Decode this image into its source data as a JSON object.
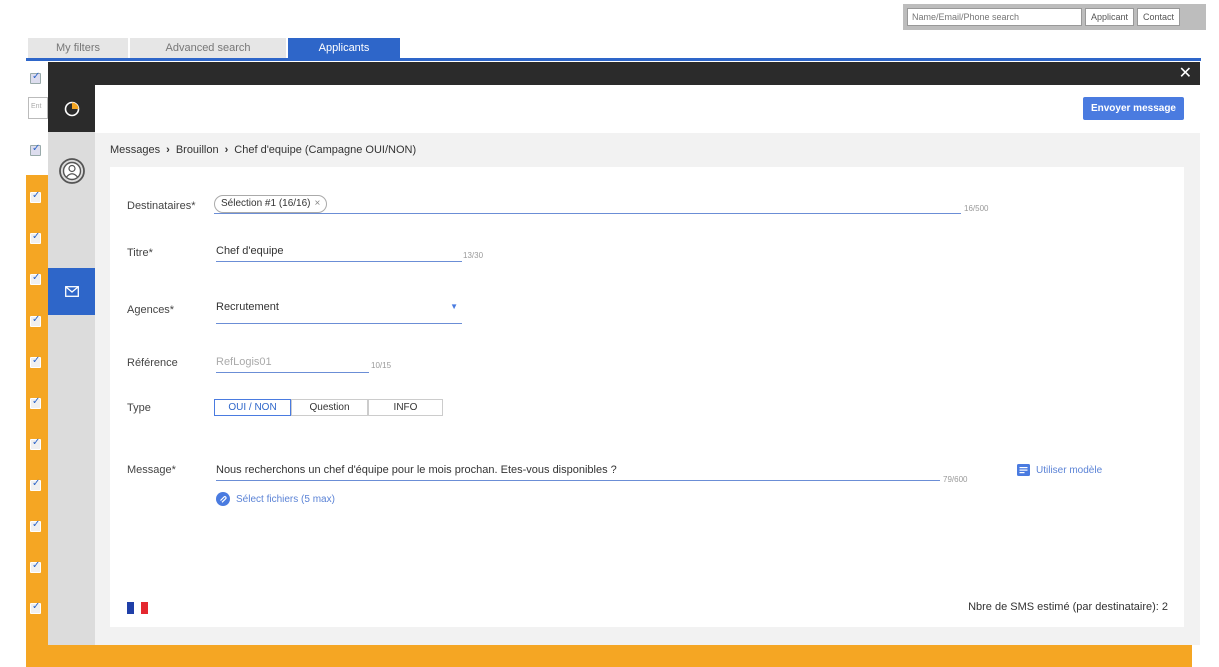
{
  "topbar": {
    "search_placeholder": "Name/Email/Phone search",
    "applicant_label": "Applicant",
    "contact_label": "Contact"
  },
  "tabs": [
    {
      "label": "My filters",
      "active": false
    },
    {
      "label": "Advanced search",
      "active": false
    },
    {
      "label": "Applicants",
      "active": true
    }
  ],
  "background": {
    "input_placeholder": "Ent"
  },
  "modal": {
    "send_button": "Envoyer message",
    "breadcrumb": [
      "Messages",
      "Brouillon",
      "Chef d'equipe (Campagne OUI/NON)"
    ],
    "form": {
      "destinataires": {
        "label": "Destinataires*",
        "chip": "Sélection #1 (16/16)",
        "count": "16/500"
      },
      "titre": {
        "label": "Titre*",
        "value": "Chef d'equipe",
        "count": "13/30"
      },
      "agences": {
        "label": "Agences*",
        "value": "Recrutement"
      },
      "reference": {
        "label": "Référence",
        "placeholder": "RefLogis01",
        "count": "10/15"
      },
      "type": {
        "label": "Type",
        "options": [
          "OUI / NON",
          "Question",
          "INFO"
        ],
        "selected": "OUI / NON"
      },
      "message": {
        "label": "Message*",
        "value": "Nous recherchons un chef d'équipe pour le mois prochan. Etes-vous disponibles ?",
        "count": "79/600"
      },
      "use_template": "Utiliser modèle",
      "select_files": "Sélect fichiers (5 max)"
    },
    "sms_estimate": "Nbre de SMS estimé (par destinataire): 2"
  },
  "colors": {
    "primary": "#2e66c9",
    "button": "#4a7be0",
    "orange": "#f5a623",
    "dark": "#2b2b2b"
  }
}
